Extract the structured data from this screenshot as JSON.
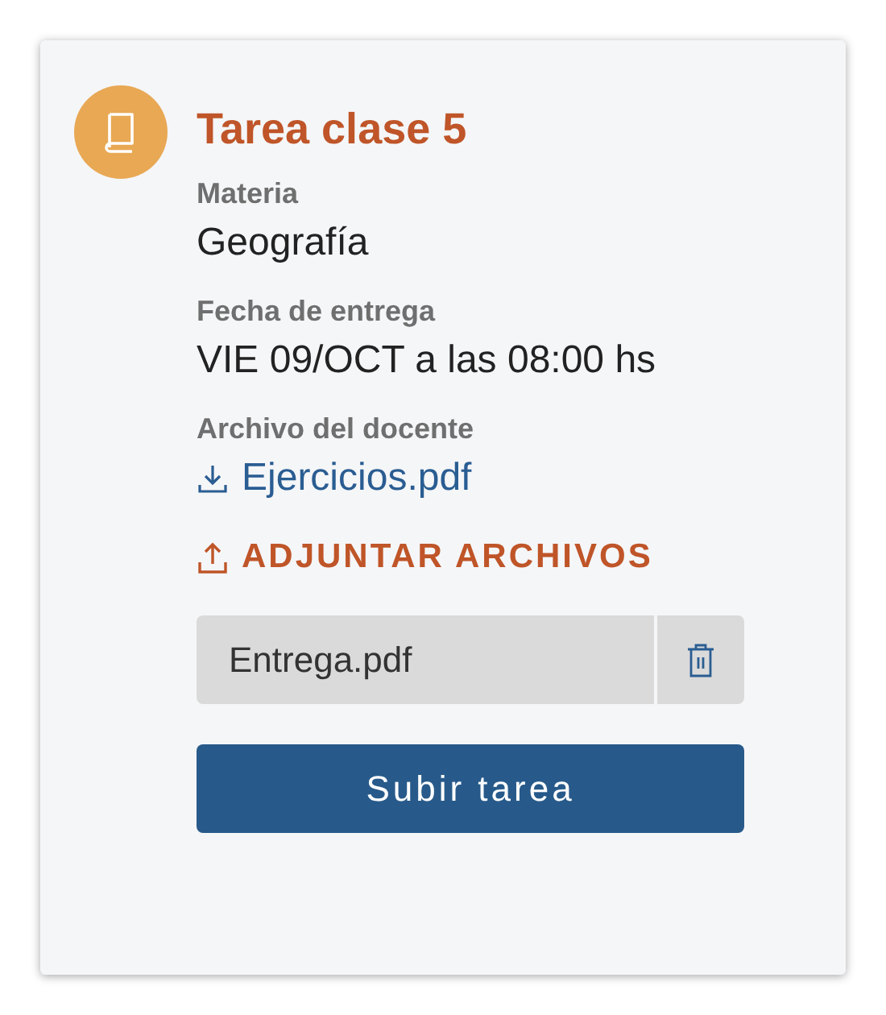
{
  "card": {
    "title": "Tarea clase 5",
    "fields": [
      {
        "kind": "text",
        "label": "Materia",
        "value": "Geografía"
      },
      {
        "kind": "text",
        "label": "Fecha de entrega",
        "value": "VIE 09/OCT a las 08:00 hs"
      },
      {
        "kind": "download",
        "label": "Archivo del docente",
        "value": "Ejercicios.pdf"
      }
    ],
    "attach_link": "ADJUNTAR ARCHIVOS",
    "attachments": [
      {
        "name": "Entrega.pdf"
      }
    ],
    "submit_button": "Subir tarea"
  }
}
